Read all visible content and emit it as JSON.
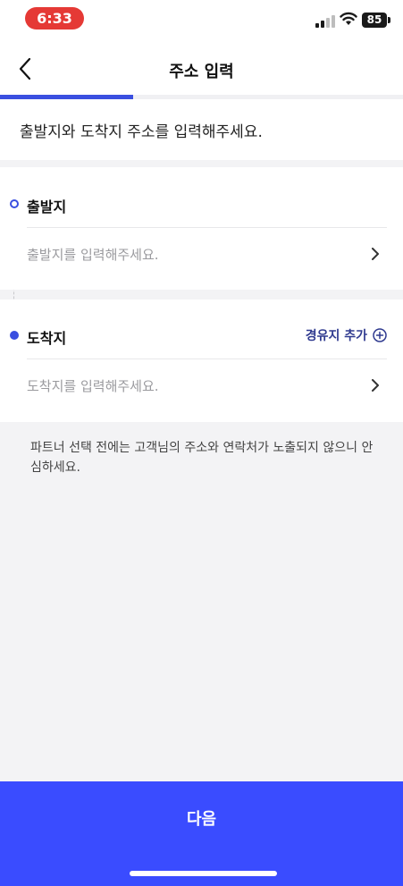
{
  "status_bar": {
    "time": "6:33",
    "battery": "85"
  },
  "header": {
    "title": "주소 입력"
  },
  "progress": {
    "fraction": 0.33
  },
  "instruction": "출발지와 도착지 주소를 입력해주세요.",
  "origin": {
    "label": "출발지",
    "placeholder": "출발지를 입력해주세요."
  },
  "destination": {
    "label": "도착지",
    "placeholder": "도착지를 입력해주세요.",
    "waypoint_label": "경유지 추가"
  },
  "notice": "파트너 선택 전에는 고객님의 주소와 연락처가 노출되지 않으니 안심하세요.",
  "footer": {
    "next_label": "다음"
  },
  "colors": {
    "accent": "#3a4fe0",
    "button": "#3a4cff",
    "status_time_bg": "#e53935"
  }
}
